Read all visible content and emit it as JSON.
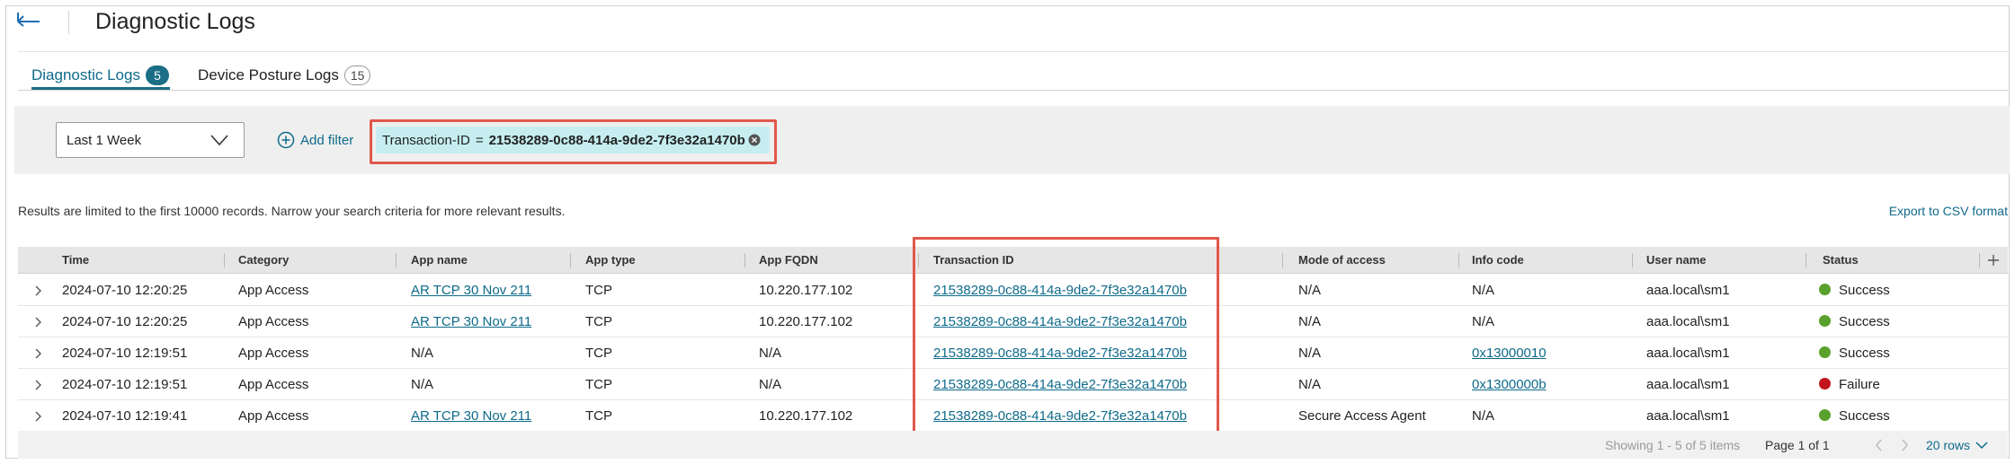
{
  "header": {
    "title": "Diagnostic Logs"
  },
  "tabs": [
    {
      "label": "Diagnostic Logs",
      "count": "5",
      "active": true
    },
    {
      "label": "Device Posture Logs",
      "count": "15",
      "active": false
    }
  ],
  "filters": {
    "time_range": "Last 1 Week",
    "add_filter_label": "Add filter",
    "chip": {
      "key": "Transaction-ID",
      "operator": "=",
      "value": "21538289-0c88-414a-9de2-7f3e32a1470b"
    }
  },
  "notice": "Results are limited to the first 10000 records. Narrow your search criteria for more relevant results.",
  "export_label": "Export to CSV format",
  "table": {
    "columns": [
      "Time",
      "Category",
      "App name",
      "App type",
      "App FQDN",
      "Transaction ID",
      "Mode of access",
      "Info code",
      "User name",
      "Status"
    ],
    "rows": [
      {
        "time": "2024-07-10 12:20:25",
        "category": "App Access",
        "app_name": "AR TCP 30 Nov 211",
        "app_type": "TCP",
        "app_fqdn": "10.220.177.102",
        "transaction_id": "21538289-0c88-414a-9de2-7f3e32a1470b",
        "mode": "N/A",
        "info_code": "N/A",
        "user": "aaa.local\\sm1",
        "status": "Success"
      },
      {
        "time": "2024-07-10 12:20:25",
        "category": "App Access",
        "app_name": "AR TCP 30 Nov 211",
        "app_type": "TCP",
        "app_fqdn": "10.220.177.102",
        "transaction_id": "21538289-0c88-414a-9de2-7f3e32a1470b",
        "mode": "N/A",
        "info_code": "N/A",
        "user": "aaa.local\\sm1",
        "status": "Success"
      },
      {
        "time": "2024-07-10 12:19:51",
        "category": "App Access",
        "app_name": "N/A",
        "app_type": "TCP",
        "app_fqdn": "N/A",
        "transaction_id": "21538289-0c88-414a-9de2-7f3e32a1470b",
        "mode": "N/A",
        "info_code": "0x13000010",
        "user": "aaa.local\\sm1",
        "status": "Success"
      },
      {
        "time": "2024-07-10 12:19:51",
        "category": "App Access",
        "app_name": "N/A",
        "app_type": "TCP",
        "app_fqdn": "N/A",
        "transaction_id": "21538289-0c88-414a-9de2-7f3e32a1470b",
        "mode": "N/A",
        "info_code": "0x1300000b",
        "user": "aaa.local\\sm1",
        "status": "Failure"
      },
      {
        "time": "2024-07-10 12:19:41",
        "category": "App Access",
        "app_name": "AR TCP 30 Nov 211",
        "app_type": "TCP",
        "app_fqdn": "10.220.177.102",
        "transaction_id": "21538289-0c88-414a-9de2-7f3e32a1470b",
        "mode": "Secure Access Agent",
        "info_code": "N/A",
        "user": "aaa.local\\sm1",
        "status": "Success"
      }
    ]
  },
  "footer": {
    "showing": "Showing 1 - 5 of 5 items",
    "page": "Page 1 of 1",
    "rows_per_page": "20 rows"
  },
  "colors": {
    "accent": "#0e6a8a",
    "success": "#5aa02c",
    "failure": "#c0161c",
    "highlight": "#e2574c",
    "chip_bg": "#c6eef0"
  }
}
